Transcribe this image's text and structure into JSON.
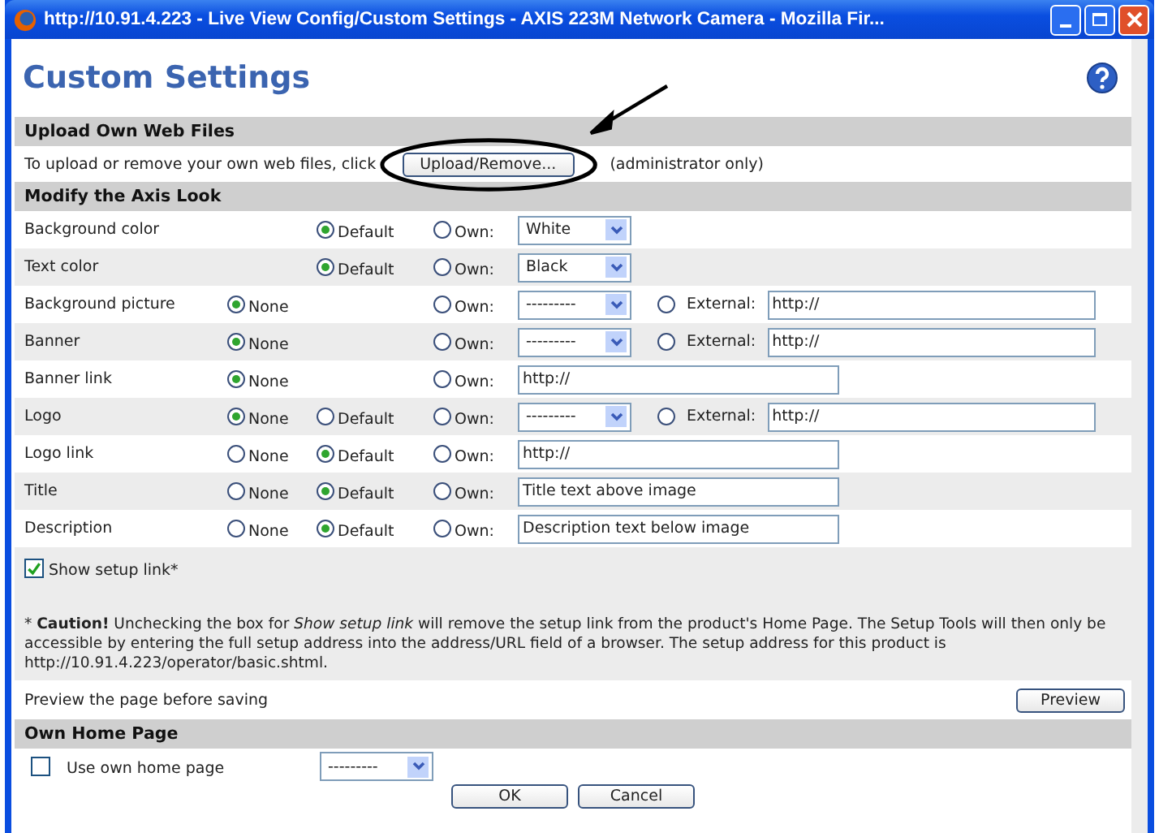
{
  "window": {
    "title": "http://10.91.4.223 - Live View Config/Custom Settings - AXIS 223M Network Camera - Mozilla Fir..."
  },
  "page_title": "Custom Settings",
  "upload": {
    "heading": "Upload Own Web Files",
    "text": "To upload or remove your own web files, click",
    "button": "Upload/Remove...",
    "note": "(administrator only)"
  },
  "look": {
    "heading": "Modify the Axis Look",
    "rows": [
      {
        "label": "Background color",
        "radios": [
          {
            "kind": "default",
            "label": "Default",
            "selected": true
          },
          {
            "kind": "own",
            "label": "Own:",
            "selected": false
          }
        ],
        "own": {
          "kind": "select",
          "value": "White"
        }
      },
      {
        "label": "Text color",
        "radios": [
          {
            "kind": "default",
            "label": "Default",
            "selected": true
          },
          {
            "kind": "own",
            "label": "Own:",
            "selected": false
          }
        ],
        "own": {
          "kind": "select",
          "value": "Black"
        }
      },
      {
        "label": "Background picture",
        "radios": [
          {
            "kind": "none",
            "label": "None",
            "selected": true
          },
          {
            "kind": "own",
            "label": "Own:",
            "selected": false
          }
        ],
        "own": {
          "kind": "select",
          "value": "---------"
        },
        "external": {
          "label": "External:",
          "value": "http://",
          "selected": false
        }
      },
      {
        "label": "Banner",
        "radios": [
          {
            "kind": "none",
            "label": "None",
            "selected": true
          },
          {
            "kind": "own",
            "label": "Own:",
            "selected": false
          }
        ],
        "own": {
          "kind": "select",
          "value": "---------"
        },
        "external": {
          "label": "External:",
          "value": "http://",
          "selected": false
        }
      },
      {
        "label": "Banner link",
        "radios": [
          {
            "kind": "none",
            "label": "None",
            "selected": true
          },
          {
            "kind": "own",
            "label": "Own:",
            "selected": false
          }
        ],
        "own": {
          "kind": "input",
          "value": "http://"
        }
      },
      {
        "label": "Logo",
        "radios": [
          {
            "kind": "none",
            "label": "None",
            "selected": true
          },
          {
            "kind": "default",
            "label": "Default",
            "selected": false
          },
          {
            "kind": "own",
            "label": "Own:",
            "selected": false
          }
        ],
        "own": {
          "kind": "select",
          "value": "---------"
        },
        "external": {
          "label": "External:",
          "value": "http://",
          "selected": false
        }
      },
      {
        "label": "Logo link",
        "radios": [
          {
            "kind": "none",
            "label": "None",
            "selected": false
          },
          {
            "kind": "default",
            "label": "Default",
            "selected": true
          },
          {
            "kind": "own",
            "label": "Own:",
            "selected": false
          }
        ],
        "own": {
          "kind": "input",
          "value": "http://"
        }
      },
      {
        "label": "Title",
        "radios": [
          {
            "kind": "none",
            "label": "None",
            "selected": false
          },
          {
            "kind": "default",
            "label": "Default",
            "selected": true
          },
          {
            "kind": "own",
            "label": "Own:",
            "selected": false
          }
        ],
        "own": {
          "kind": "input",
          "value": "Title text above image"
        }
      },
      {
        "label": "Description",
        "radios": [
          {
            "kind": "none",
            "label": "None",
            "selected": false
          },
          {
            "kind": "default",
            "label": "Default",
            "selected": true
          },
          {
            "kind": "own",
            "label": "Own:",
            "selected": false
          }
        ],
        "own": {
          "kind": "input",
          "value": "Description text below image"
        }
      }
    ],
    "setup_link": {
      "label": "Show setup link*",
      "checked": true
    },
    "caution": "* **Caution!** Unchecking the box for *Show setup link* will remove the setup link from the product's Home Page. The Setup Tools will then only be accessible by entering the full setup address into the address/URL field of a browser. The setup address for this product is http://10.91.4.223/operator/basic.shtml.",
    "preview": {
      "text": "Preview the page before saving",
      "button": "Preview"
    }
  },
  "home": {
    "heading": "Own Home Page",
    "label": "Use own home page",
    "checked": false,
    "select": "---------"
  },
  "buttons": [
    "OK",
    "Cancel"
  ]
}
